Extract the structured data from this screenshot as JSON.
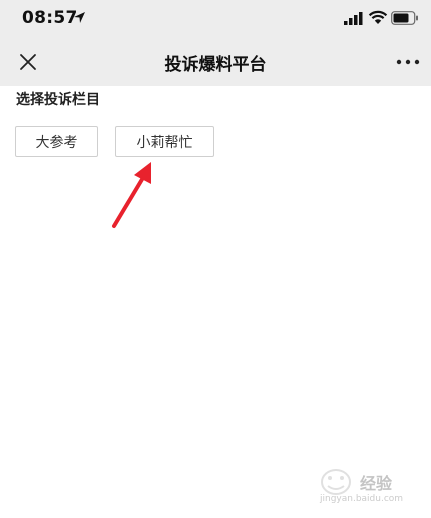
{
  "status_bar": {
    "time": "08:57"
  },
  "nav": {
    "title": "投诉爆料平台"
  },
  "section": {
    "heading": "选择投诉栏目"
  },
  "options": [
    {
      "label": "大参考"
    },
    {
      "label": "小莉帮忙"
    }
  ],
  "watermark": {
    "text": "经验",
    "url": "jingyan.baidu.com"
  },
  "colors": {
    "bar_background": "#ededed",
    "arrow": "#e8222d",
    "button_border": "#cfcfcf"
  }
}
